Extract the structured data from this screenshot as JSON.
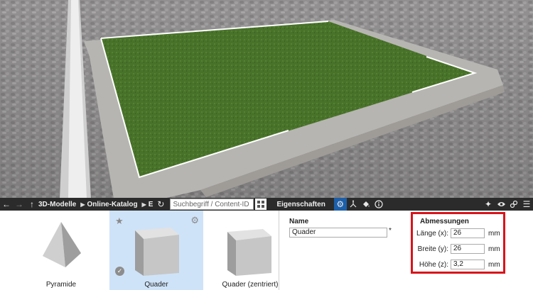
{
  "toolbar": {
    "back_icon": "arrow-left-icon",
    "forward_icon": "arrow-right-icon",
    "up_icon": "arrow-up-icon",
    "breadcrumbs": [
      "3D-Modelle",
      "Online-Katalog",
      "E"
    ],
    "search_placeholder": "Suchbegriff / Content-ID",
    "properties_title": "Eigenschaften"
  },
  "catalog": {
    "items": [
      {
        "label": "Pyramide"
      },
      {
        "label": "Quader"
      },
      {
        "label": "Quader (zentriert)"
      }
    ]
  },
  "properties": {
    "name_label": "Name",
    "name_value": "Quader",
    "required_mark": "*",
    "dimensions_title": "Abmessungen",
    "length_label": "Länge (x):",
    "length_value": "26",
    "width_label": "Breite (y):",
    "width_value": "26",
    "height_label": "Höhe (z):",
    "height_value": "3,2",
    "unit": "mm"
  },
  "colors": {
    "toolbar_bg": "#2b2b2b",
    "active_tab": "#1d5fa8",
    "selected_tile": "#cfe3f8",
    "highlight_border": "#d8141b"
  }
}
